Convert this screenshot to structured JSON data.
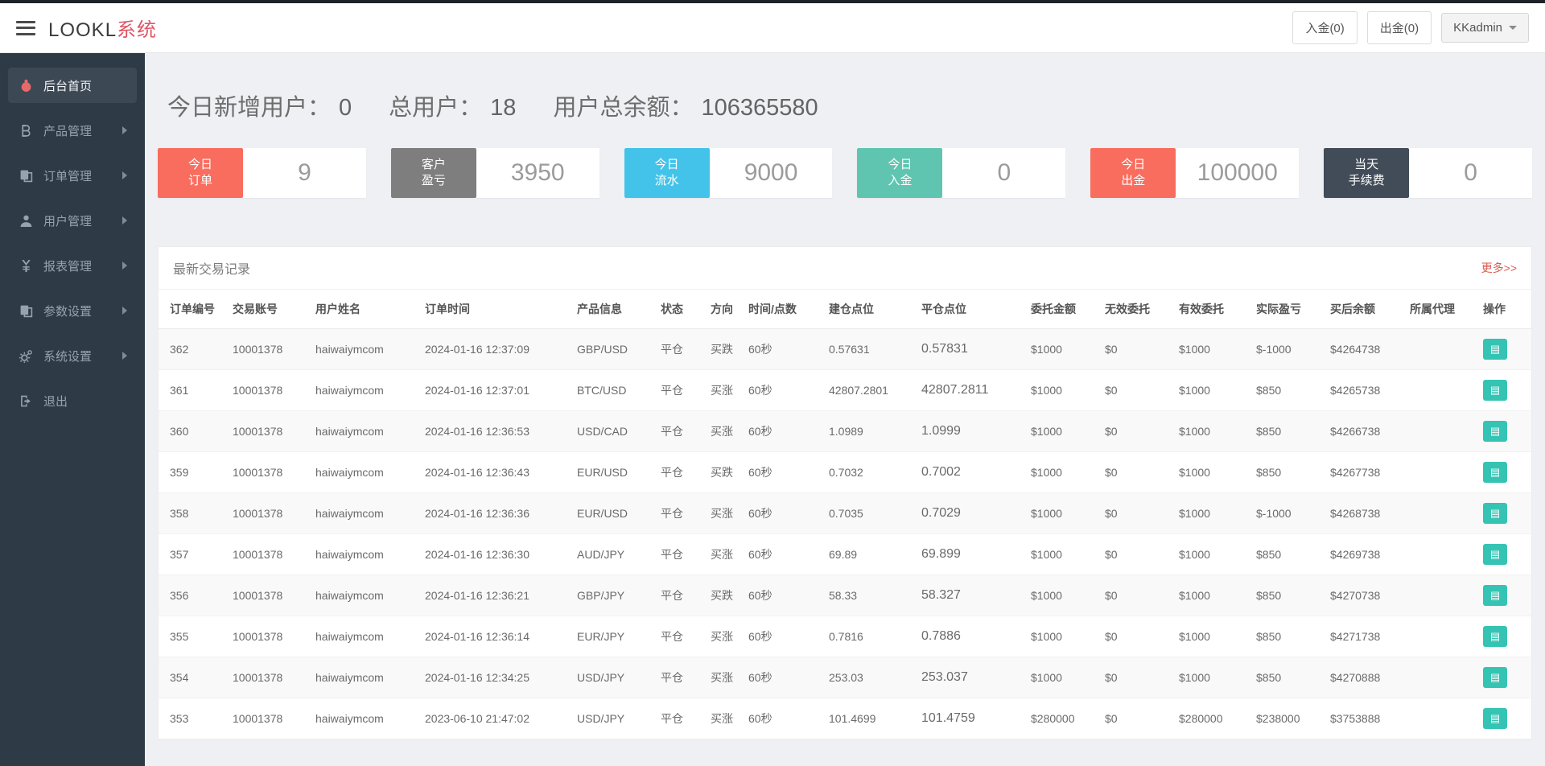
{
  "topbar": {
    "brand": "LOOKL",
    "brand_suffix": "系统",
    "deposit_label": "入金(0)",
    "withdraw_label": "出金(0)",
    "user_label": "KKadmin"
  },
  "sidebar": {
    "items": [
      {
        "label": "后台首页",
        "icon": "dashboard-icon",
        "active": true,
        "has_children": false
      },
      {
        "label": "产品管理",
        "icon": "bitcoin-icon",
        "active": false,
        "has_children": true
      },
      {
        "label": "订单管理",
        "icon": "orders-icon",
        "active": false,
        "has_children": true
      },
      {
        "label": "用户管理",
        "icon": "user-icon",
        "active": false,
        "has_children": true
      },
      {
        "label": "报表管理",
        "icon": "yen-icon",
        "active": false,
        "has_children": true
      },
      {
        "label": "参数设置",
        "icon": "params-icon",
        "active": false,
        "has_children": true
      },
      {
        "label": "系统设置",
        "icon": "gears-icon",
        "active": false,
        "has_children": true
      },
      {
        "label": "退出",
        "icon": "logout-icon",
        "active": false,
        "has_children": false
      }
    ]
  },
  "summary": {
    "new_users_label": "今日新增用户：",
    "new_users_value": "0",
    "total_users_label": "总用户：",
    "total_users_value": "18",
    "total_balance_label": "用户总余额：",
    "total_balance_value": "106365580"
  },
  "cards": [
    {
      "line1": "今日",
      "line2": "订单",
      "value": "9",
      "color": "#f96d5e"
    },
    {
      "line1": "客户",
      "line2": "盈亏",
      "value": "3950",
      "color": "#7e7e7e"
    },
    {
      "line1": "今日",
      "line2": "流水",
      "value": "9000",
      "color": "#43c3ea"
    },
    {
      "line1": "今日",
      "line2": "入金",
      "value": "0",
      "color": "#5fc5b1"
    },
    {
      "line1": "今日",
      "line2": "出金",
      "value": "100000",
      "color": "#f96d5e"
    },
    {
      "line1": "当天",
      "line2": "手续费",
      "value": "0",
      "color": "#414c58"
    }
  ],
  "panel": {
    "title": "最新交易记录",
    "more_label": "更多>>",
    "columns": [
      "订单编号",
      "交易账号",
      "用户姓名",
      "订单时间",
      "产品信息",
      "状态",
      "方向",
      "时间/点数",
      "建仓点位",
      "平仓点位",
      "委托金额",
      "无效委托",
      "有效委托",
      "实际盈亏",
      "买后余额",
      "所属代理",
      "操作"
    ],
    "action_icon": "table-icon",
    "rows": [
      {
        "order_no": "362",
        "account": "10001378",
        "username": "haiwaiymcom",
        "time": "2024-01-16 12:37:09",
        "product": "GBP/USD",
        "status": "平仓",
        "direction": "买跌",
        "dir_color": "green",
        "duration": "60秒",
        "open_price": "0.57631",
        "close_price": "0.57831",
        "close_color": "red",
        "amount": "$1000",
        "invalid": "$0",
        "valid": "$1000",
        "profit": "$-1000",
        "profit_color": "green",
        "balance": "$4264738",
        "agent": ""
      },
      {
        "order_no": "361",
        "account": "10001378",
        "username": "haiwaiymcom",
        "time": "2024-01-16 12:37:01",
        "product": "BTC/USD",
        "status": "平仓",
        "direction": "买涨",
        "dir_color": "red",
        "duration": "60秒",
        "open_price": "42807.2801",
        "close_price": "42807.2811",
        "close_color": "red",
        "amount": "$1000",
        "invalid": "$0",
        "valid": "$1000",
        "profit": "$850",
        "profit_color": "red",
        "balance": "$4265738",
        "agent": ""
      },
      {
        "order_no": "360",
        "account": "10001378",
        "username": "haiwaiymcom",
        "time": "2024-01-16 12:36:53",
        "product": "USD/CAD",
        "status": "平仓",
        "direction": "买涨",
        "dir_color": "red",
        "duration": "60秒",
        "open_price": "1.0989",
        "close_price": "1.0999",
        "close_color": "red",
        "amount": "$1000",
        "invalid": "$0",
        "valid": "$1000",
        "profit": "$850",
        "profit_color": "red",
        "balance": "$4266738",
        "agent": ""
      },
      {
        "order_no": "359",
        "account": "10001378",
        "username": "haiwaiymcom",
        "time": "2024-01-16 12:36:43",
        "product": "EUR/USD",
        "status": "平仓",
        "direction": "买跌",
        "dir_color": "green",
        "duration": "60秒",
        "open_price": "0.7032",
        "close_price": "0.7002",
        "close_color": "green",
        "amount": "$1000",
        "invalid": "$0",
        "valid": "$1000",
        "profit": "$850",
        "profit_color": "red",
        "balance": "$4267738",
        "agent": ""
      },
      {
        "order_no": "358",
        "account": "10001378",
        "username": "haiwaiymcom",
        "time": "2024-01-16 12:36:36",
        "product": "EUR/USD",
        "status": "平仓",
        "direction": "买涨",
        "dir_color": "red",
        "duration": "60秒",
        "open_price": "0.7035",
        "close_price": "0.7029",
        "close_color": "green",
        "amount": "$1000",
        "invalid": "$0",
        "valid": "$1000",
        "profit": "$-1000",
        "profit_color": "green",
        "balance": "$4268738",
        "agent": ""
      },
      {
        "order_no": "357",
        "account": "10001378",
        "username": "haiwaiymcom",
        "time": "2024-01-16 12:36:30",
        "product": "AUD/JPY",
        "status": "平仓",
        "direction": "买涨",
        "dir_color": "red",
        "duration": "60秒",
        "open_price": "69.89",
        "close_price": "69.899",
        "close_color": "red",
        "amount": "$1000",
        "invalid": "$0",
        "valid": "$1000",
        "profit": "$850",
        "profit_color": "red",
        "balance": "$4269738",
        "agent": ""
      },
      {
        "order_no": "356",
        "account": "10001378",
        "username": "haiwaiymcom",
        "time": "2024-01-16 12:36:21",
        "product": "GBP/JPY",
        "status": "平仓",
        "direction": "买跌",
        "dir_color": "green",
        "duration": "60秒",
        "open_price": "58.33",
        "close_price": "58.327",
        "close_color": "green",
        "amount": "$1000",
        "invalid": "$0",
        "valid": "$1000",
        "profit": "$850",
        "profit_color": "red",
        "balance": "$4270738",
        "agent": ""
      },
      {
        "order_no": "355",
        "account": "10001378",
        "username": "haiwaiymcom",
        "time": "2024-01-16 12:36:14",
        "product": "EUR/JPY",
        "status": "平仓",
        "direction": "买涨",
        "dir_color": "red",
        "duration": "60秒",
        "open_price": "0.7816",
        "close_price": "0.7886",
        "close_color": "red",
        "amount": "$1000",
        "invalid": "$0",
        "valid": "$1000",
        "profit": "$850",
        "profit_color": "red",
        "balance": "$4271738",
        "agent": ""
      },
      {
        "order_no": "354",
        "account": "10001378",
        "username": "haiwaiymcom",
        "time": "2024-01-16 12:34:25",
        "product": "USD/JPY",
        "status": "平仓",
        "direction": "买涨",
        "dir_color": "red",
        "duration": "60秒",
        "open_price": "253.03",
        "close_price": "253.037",
        "close_color": "red",
        "amount": "$1000",
        "invalid": "$0",
        "valid": "$1000",
        "profit": "$850",
        "profit_color": "red",
        "balance": "$4270888",
        "agent": ""
      },
      {
        "order_no": "353",
        "account": "10001378",
        "username": "haiwaiymcom",
        "time": "2023-06-10 21:47:02",
        "product": "USD/JPY",
        "status": "平仓",
        "direction": "买涨",
        "dir_color": "red",
        "duration": "60秒",
        "open_price": "101.4699",
        "close_price": "101.4759",
        "close_color": "red",
        "amount": "$280000",
        "invalid": "$0",
        "valid": "$280000",
        "profit": "$238000",
        "profit_color": "red",
        "balance": "$3753888",
        "agent": ""
      }
    ]
  }
}
